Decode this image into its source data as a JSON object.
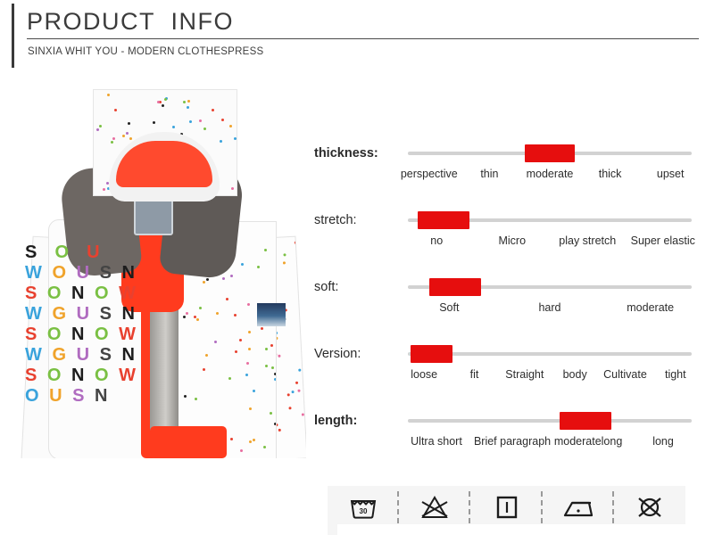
{
  "header": {
    "title": "PRODUCT  INFO",
    "subtitle": "SINXIA WHIT YOU - MODERN CLOTHESPRESS",
    "accent_color": "#3a3a3a"
  },
  "product_image": {
    "alt": "white hooded ski jacket with polka dots and SNOW letter print",
    "colors": {
      "shell": "#fbfbfb",
      "lining": "#ff3b1e",
      "inner_panel": "#6d6763"
    },
    "letter_print": [
      "S  O  U",
      "W O U S N",
      "S O N O W",
      "W G U S N",
      "S O N O W",
      "W G U S N",
      "S O N O W",
      "O U S N"
    ]
  },
  "specs": {
    "slider_color": "#e60e0e",
    "track_color": "#d2d2d2",
    "rows": [
      {
        "label": "thickness:",
        "bold": true,
        "selected_index": 2,
        "options": [
          "perspective",
          "thin",
          "moderate",
          "thick",
          "upset"
        ]
      },
      {
        "label": "stretch:",
        "bold": false,
        "selected_index": 0,
        "options": [
          "no",
          "Micro",
          "play stretch",
          "Super elastic"
        ]
      },
      {
        "label": "soft:",
        "bold": false,
        "selected_index": 0,
        "options": [
          "Soft",
          "hard",
          "moderate"
        ]
      },
      {
        "label": "Version:",
        "bold": false,
        "selected_index": 0,
        "options": [
          "loose",
          "fit",
          "Straight",
          "body",
          "Cultivate",
          "tight"
        ]
      },
      {
        "label": "length:",
        "bold": true,
        "selected_index": 2,
        "options": [
          "Ultra short",
          "Brief paragraph",
          "moderatelong",
          "long"
        ]
      }
    ]
  },
  "care": {
    "background": "#f5f5f5",
    "symbols": [
      {
        "name": "wash-30-icon",
        "label": "30",
        "meaning": "machine wash at 30 degrees"
      },
      {
        "name": "do-not-bleach-icon",
        "label": "",
        "meaning": "do not bleach"
      },
      {
        "name": "drip-dry-icon",
        "label": "",
        "meaning": "drip dry / hang to dry"
      },
      {
        "name": "iron-low-icon",
        "label": "",
        "meaning": "iron low temperature"
      },
      {
        "name": "do-not-dry-clean-icon",
        "label": "",
        "meaning": "do not dry clean"
      }
    ]
  }
}
